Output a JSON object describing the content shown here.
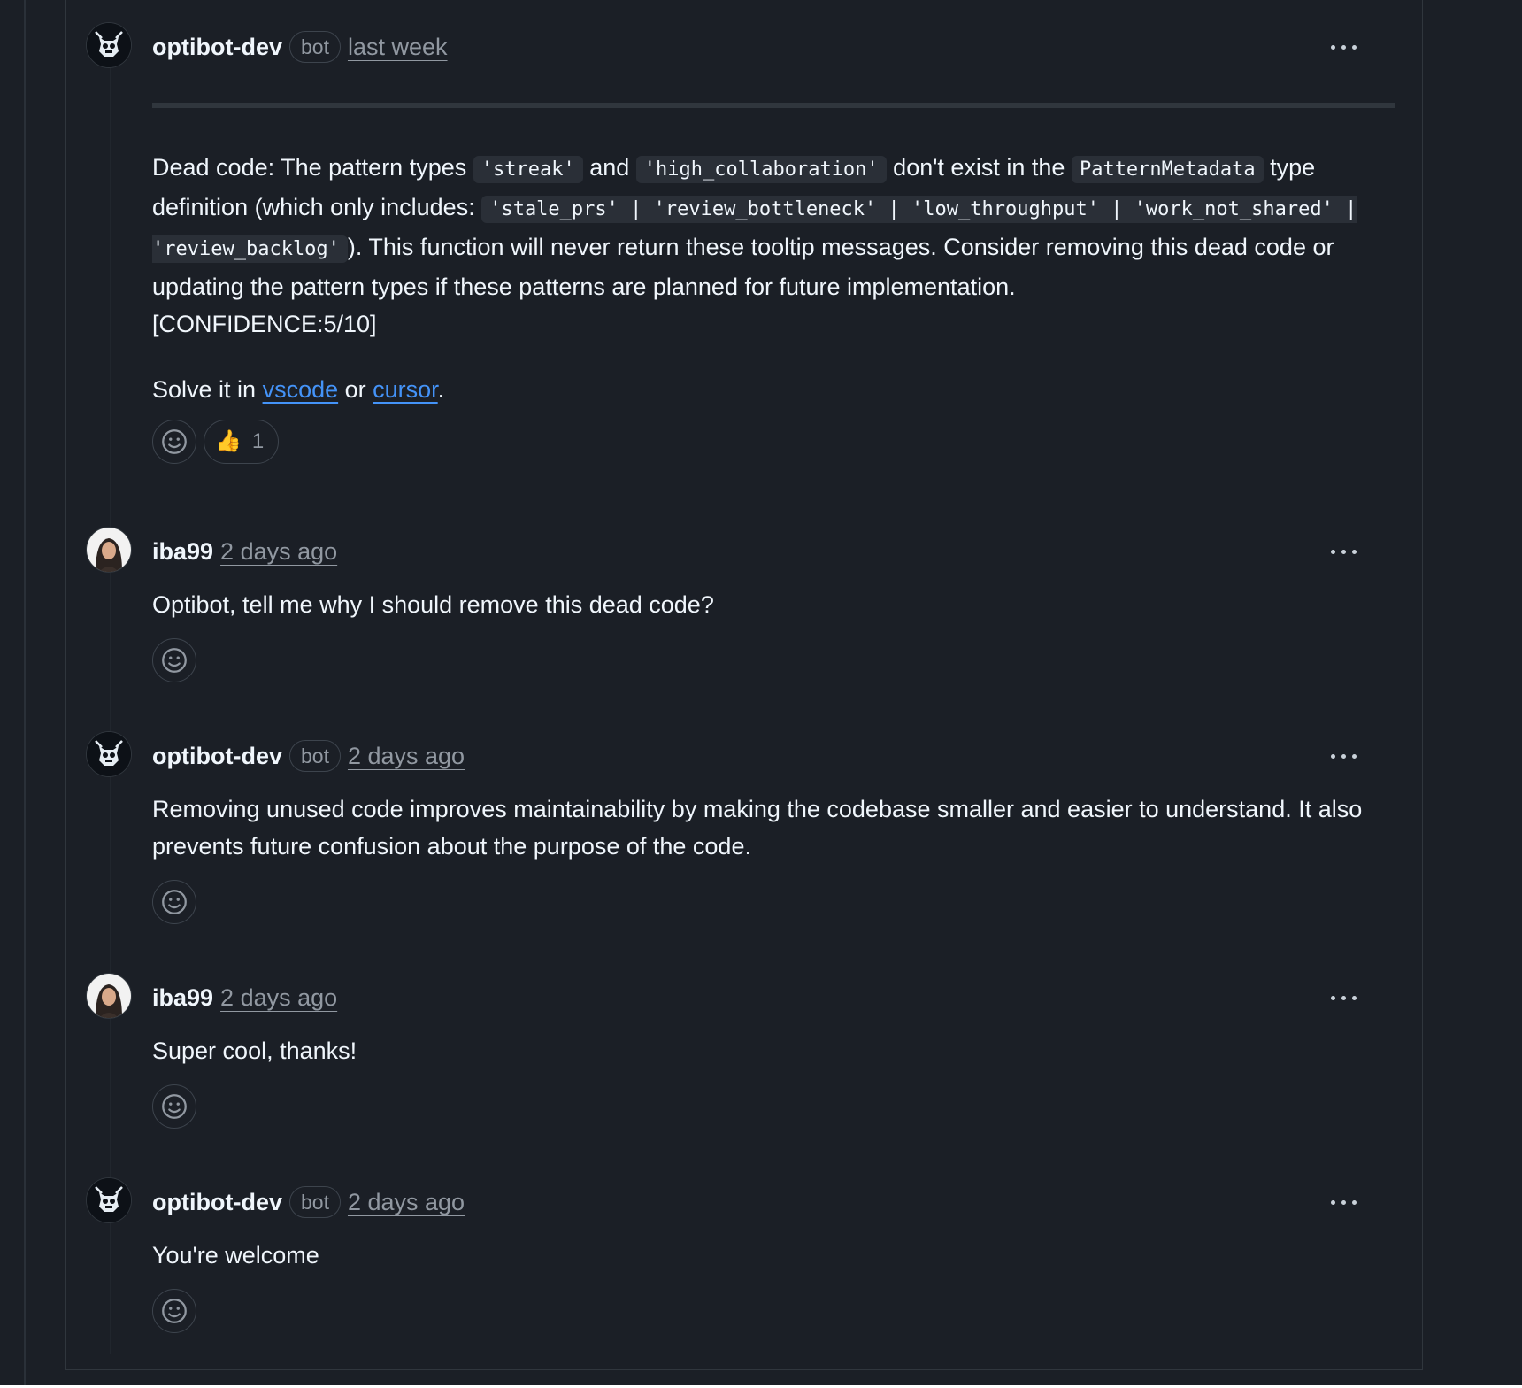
{
  "comments": [
    {
      "author": "optibot-dev",
      "badge": "bot",
      "time": "last week",
      "body": {
        "p1_a": "Dead code: The pattern types ",
        "code1": "'streak'",
        "p1_b": " and ",
        "code2": "'high_collaboration'",
        "p1_c": " don't exist in the ",
        "code3": "PatternMetadata",
        "p1_d": " type definition (which only includes: ",
        "code4": "'stale_prs' | 'review_bottleneck' | 'low_throughput' | 'work_not_shared' | 'review_backlog'",
        "p1_e": "). This function will never return these tooltip messages. Consider removing this dead code or updating the pattern types if these patterns are planned for future implementation.",
        "confidence": "[CONFIDENCE:5/10]",
        "solve_prefix": "Solve it in ",
        "link_vscode": "vscode",
        "solve_or": " or ",
        "link_cursor": "cursor",
        "solve_suffix": "."
      },
      "reaction": {
        "emoji": "👍",
        "count": "1"
      }
    },
    {
      "author": "iba99",
      "time": "2 days ago",
      "body": "Optibot, tell me why I should remove this dead code?"
    },
    {
      "author": "optibot-dev",
      "badge": "bot",
      "time": "2 days ago",
      "body": "Removing unused code improves maintainability by making the codebase smaller and easier to understand. It also prevents future confusion about the purpose of the code."
    },
    {
      "author": "iba99",
      "time": "2 days ago",
      "body": "Super cool, thanks!"
    },
    {
      "author": "optibot-dev",
      "badge": "bot",
      "time": "2 days ago",
      "body": "You're welcome"
    }
  ],
  "icons": {
    "more": "kebab-horizontal-icon",
    "add_reaction": "smiley-icon",
    "bot_avatar": "robot-avatar",
    "user_avatar": "user-avatar"
  },
  "colors": {
    "background": "#1b1f26",
    "link": "#4493f8",
    "muted": "#9198a1",
    "border": "#3d444d"
  }
}
